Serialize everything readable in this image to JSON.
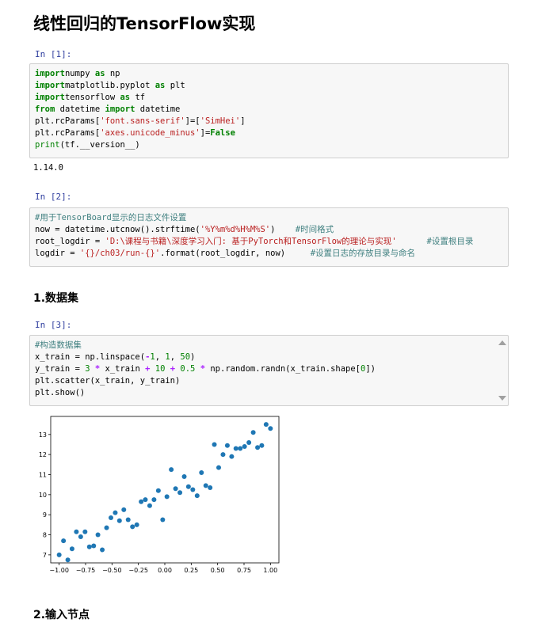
{
  "page_title": "线性回归的TensorFlow实现",
  "cells": {
    "c1": {
      "prompt": "In  [1]:",
      "lines": [
        [
          [
            "kw",
            "import"
          ],
          [
            "",
            "numpy"
          ],
          [
            "kw",
            " as"
          ],
          [
            "",
            " np"
          ]
        ],
        [
          [
            "kw",
            "import"
          ],
          [
            "",
            "matplotlib.pyplot"
          ],
          [
            "kw",
            " as"
          ],
          [
            "",
            " plt"
          ]
        ],
        [
          [
            "kw",
            "import"
          ],
          [
            "",
            "tensorflow"
          ],
          [
            "kw",
            " as"
          ],
          [
            "",
            " tf"
          ]
        ],
        [
          [
            "kw",
            "from"
          ],
          [
            "",
            " datetime "
          ],
          [
            "kw",
            "import"
          ],
          [
            "",
            " datetime"
          ]
        ],
        [
          [
            "",
            "plt.rcParams["
          ],
          [
            "str",
            "'font.sans-serif'"
          ],
          [
            "",
            "]=["
          ],
          [
            "str",
            "'SimHei'"
          ],
          [
            "",
            "]"
          ]
        ],
        [
          [
            "",
            "plt.rcParams["
          ],
          [
            "str",
            "'axes.unicode_minus'"
          ],
          [
            "",
            "]="
          ],
          [
            "kw",
            "False"
          ]
        ],
        [
          [
            "bi",
            "print"
          ],
          [
            "",
            "(tf.__version__)"
          ]
        ]
      ],
      "output": "1.14.0"
    },
    "c2": {
      "prompt": "In  [2]:",
      "lines": [
        [
          [
            "cm",
            "#用于TensorBoard显示的日志文件设置"
          ]
        ],
        [
          [
            "",
            "now = datetime.utcnow().strftime("
          ],
          [
            "str",
            "'%Y%m%d%H%M%S'"
          ],
          [
            "",
            ")    "
          ],
          [
            "cm",
            "#时间格式"
          ]
        ],
        [
          [
            "",
            "root_logdir = "
          ],
          [
            "str",
            "'D:\\课程与书籍\\深度学习入门: 基于PyTorch和TensorFlow的理论与实现'"
          ],
          [
            "",
            "      "
          ],
          [
            "cm",
            "#设置根目录"
          ]
        ],
        [
          [
            "",
            "logdir = "
          ],
          [
            "str",
            "'{}/ch03/run-{}'"
          ],
          [
            "",
            ".format(root_logdir, now)     "
          ],
          [
            "cm",
            "#设置日志的存放目录与命名"
          ]
        ]
      ]
    },
    "c3": {
      "prompt": "In  [3]:",
      "lines": [
        [
          [
            "cm",
            "#构造数据集"
          ]
        ],
        [
          [
            "",
            "x_train = np.linspace("
          ],
          [
            "op",
            "-"
          ],
          [
            "num",
            "1"
          ],
          [
            "",
            ", "
          ],
          [
            "num",
            "1"
          ],
          [
            "",
            ", "
          ],
          [
            "num",
            "50"
          ],
          [
            "",
            ")"
          ]
        ],
        [
          [
            "",
            "y_train = "
          ],
          [
            "num",
            "3"
          ],
          [
            "",
            " "
          ],
          [
            "op",
            "*"
          ],
          [
            "",
            " x_train "
          ],
          [
            "op",
            "+"
          ],
          [
            "",
            " "
          ],
          [
            "num",
            "10"
          ],
          [
            "",
            " "
          ],
          [
            "op",
            "+"
          ],
          [
            "",
            " "
          ],
          [
            "num",
            "0.5"
          ],
          [
            "",
            " "
          ],
          [
            "op",
            "*"
          ],
          [
            "",
            " np.random.randn(x_train.shape["
          ],
          [
            "num",
            "0"
          ],
          [
            "",
            "])"
          ]
        ],
        [
          [
            "",
            "plt.scatter(x_train, y_train)"
          ]
        ],
        [
          [
            "",
            "plt.show()"
          ]
        ]
      ]
    }
  },
  "sections": {
    "s1": "1.数据集",
    "s2": "2.输入节点"
  },
  "chart_data": {
    "type": "scatter",
    "color": "#1f77b4",
    "xlim": [
      -1.08,
      1.08
    ],
    "ylim": [
      6.6,
      13.9
    ],
    "xticks": [
      "−1.00",
      "−0.75",
      "−0.50",
      "−0.25",
      "0.00",
      "0.25",
      "0.50",
      "0.75",
      "1.00"
    ],
    "xtick_values": [
      -1,
      -0.75,
      -0.5,
      -0.25,
      0,
      0.25,
      0.5,
      0.75,
      1
    ],
    "yticks": [
      "7",
      "8",
      "9",
      "10",
      "11",
      "12",
      "13"
    ],
    "ytick_values": [
      7,
      8,
      9,
      10,
      11,
      12,
      13
    ],
    "x": [
      -1.0,
      -0.959,
      -0.918,
      -0.878,
      -0.837,
      -0.796,
      -0.755,
      -0.714,
      -0.673,
      -0.633,
      -0.592,
      -0.551,
      -0.51,
      -0.469,
      -0.429,
      -0.388,
      -0.347,
      -0.306,
      -0.265,
      -0.224,
      -0.184,
      -0.143,
      -0.102,
      -0.061,
      -0.02,
      0.02,
      0.061,
      0.102,
      0.143,
      0.184,
      0.224,
      0.265,
      0.306,
      0.347,
      0.388,
      0.429,
      0.469,
      0.51,
      0.551,
      0.592,
      0.633,
      0.673,
      0.714,
      0.755,
      0.796,
      0.837,
      0.878,
      0.918,
      0.959,
      1.0
    ],
    "y": [
      7.0,
      7.7,
      6.75,
      7.3,
      8.15,
      7.9,
      8.15,
      7.4,
      7.45,
      8.0,
      7.25,
      8.35,
      8.85,
      9.1,
      8.7,
      9.25,
      8.75,
      8.4,
      8.5,
      9.65,
      9.75,
      9.45,
      9.75,
      10.2,
      8.75,
      9.9,
      11.25,
      10.3,
      10.1,
      10.9,
      10.4,
      10.25,
      9.95,
      11.1,
      10.45,
      10.35,
      12.5,
      11.35,
      12.0,
      12.45,
      11.9,
      12.3,
      12.3,
      12.4,
      12.6,
      13.1,
      12.35,
      12.45,
      13.5,
      13.3
    ]
  }
}
